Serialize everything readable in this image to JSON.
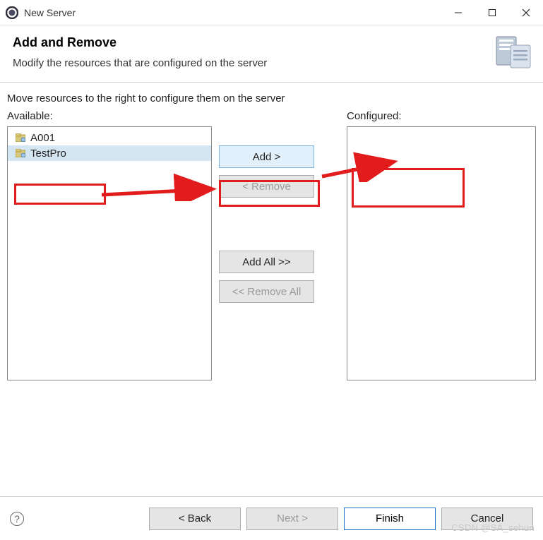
{
  "titlebar": {
    "title": "New Server"
  },
  "header": {
    "title": "Add and Remove",
    "description": "Modify the resources that are configured on the server"
  },
  "body": {
    "instruction": "Move resources to the right to configure them on the server",
    "available_label": "Available:",
    "configured_label": "Configured:",
    "available_items": [
      {
        "label": "A001",
        "selected": false
      },
      {
        "label": "TestPro",
        "selected": true
      }
    ]
  },
  "buttons": {
    "add": "Add >",
    "remove": "< Remove",
    "add_all": "Add All >>",
    "remove_all": "<< Remove All"
  },
  "footer": {
    "back": "< Back",
    "next": "Next >",
    "finish": "Finish",
    "cancel": "Cancel",
    "help": "?"
  },
  "watermark": "CSDN @SA_sehun"
}
